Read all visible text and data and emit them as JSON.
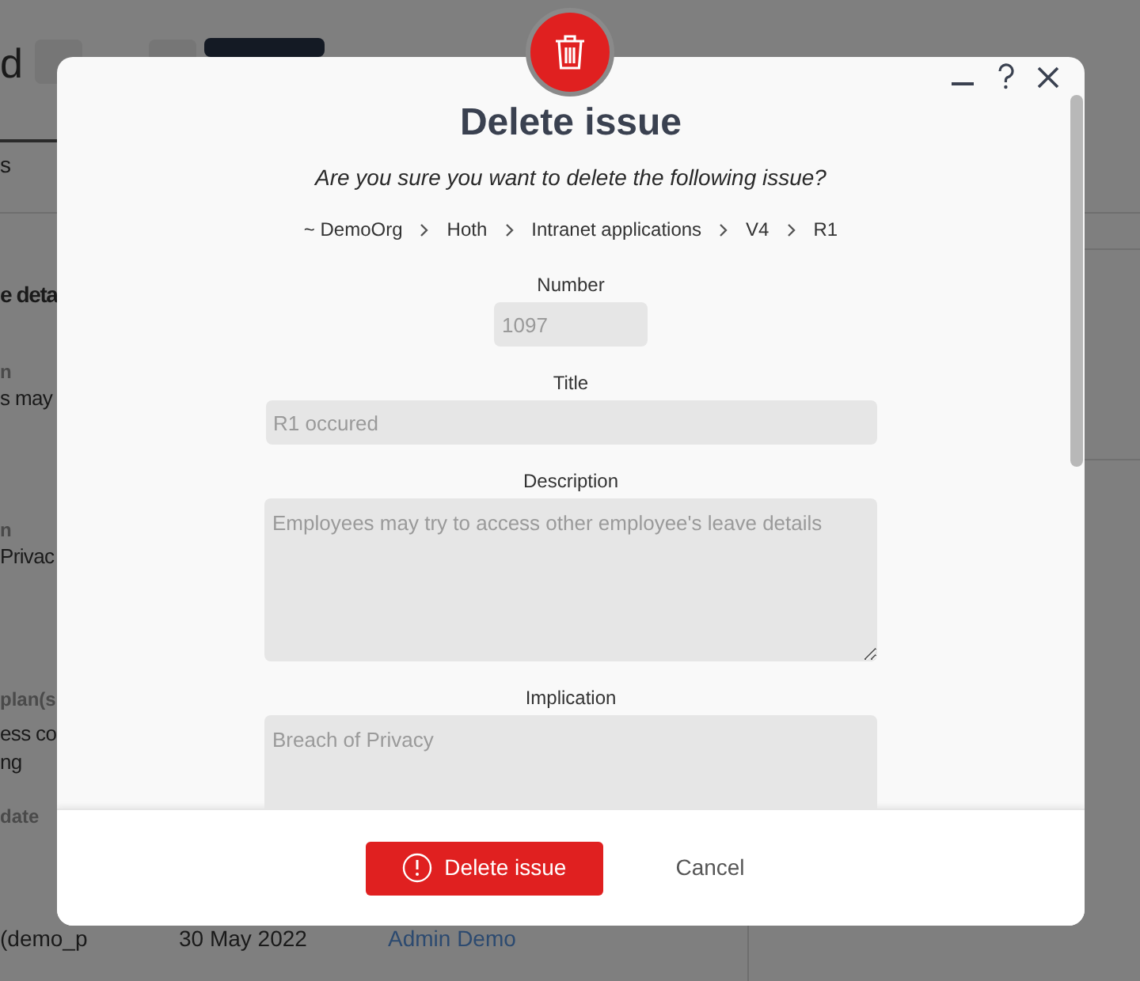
{
  "background": {
    "fragments": [
      {
        "kind": "heading",
        "text": "d"
      },
      {
        "kind": "tab",
        "text": "s"
      },
      {
        "kind": "section",
        "text": "e deta"
      },
      {
        "kind": "label",
        "text": "n"
      },
      {
        "kind": "value",
        "text": "s may"
      },
      {
        "kind": "label",
        "text": "n"
      },
      {
        "kind": "value",
        "text": "Privac"
      },
      {
        "kind": "label",
        "text": "plan(s"
      },
      {
        "kind": "value",
        "text": "ess co"
      },
      {
        "kind": "value",
        "text": "ng"
      },
      {
        "kind": "label",
        "text": "date"
      }
    ],
    "row": {
      "user": "(demo_p",
      "date": "30 May 2022",
      "author": "Admin Demo"
    }
  },
  "dialog": {
    "title": "Delete issue",
    "question": "Are you sure you want to delete the following issue?",
    "breadcrumb": [
      "~ DemoOrg",
      "Hoth",
      "Intranet applications",
      "V4",
      "R1"
    ],
    "fields": [
      {
        "kind": "short",
        "label": "Number",
        "value": "1097"
      },
      {
        "kind": "line",
        "label": "Title",
        "value": "R1 occured"
      },
      {
        "kind": "area",
        "label": "Description",
        "value": "Employees may try to access other employee's leave details"
      },
      {
        "kind": "area",
        "label": "Implication",
        "value": "Breach of Privacy"
      }
    ],
    "confirm": "Delete issue",
    "cancel": "Cancel"
  }
}
